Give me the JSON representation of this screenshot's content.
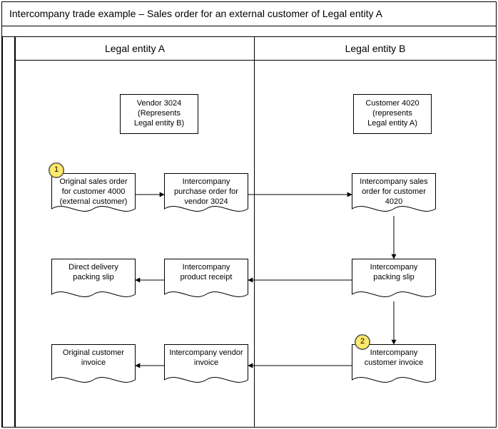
{
  "title": "Intercompany trade example – Sales order for an external customer of Legal entity A",
  "entityA": {
    "header": "Legal entity A"
  },
  "entityB": {
    "header": "Legal entity B"
  },
  "boxes": {
    "vendor": "Vendor 3024\n(Represents\nLegal entity B)",
    "customer": "Customer 4020\n(represents\nLegal entity A)",
    "a1": "Original sales order for customer 4000 (external customer)",
    "a2": "Intercompany purchase order for vendor 3024",
    "b1": "Intercompany sales order for customer 4020",
    "a3": "Direct delivery packing slip",
    "a4": "Intercompany product receipt",
    "b2": "Intercompany packing slip",
    "a5": "Original customer invoice",
    "a6": "Intercompany vendor invoice",
    "b3": "Intercompany customer invoice"
  },
  "badges": {
    "one": "1",
    "two": "2"
  }
}
